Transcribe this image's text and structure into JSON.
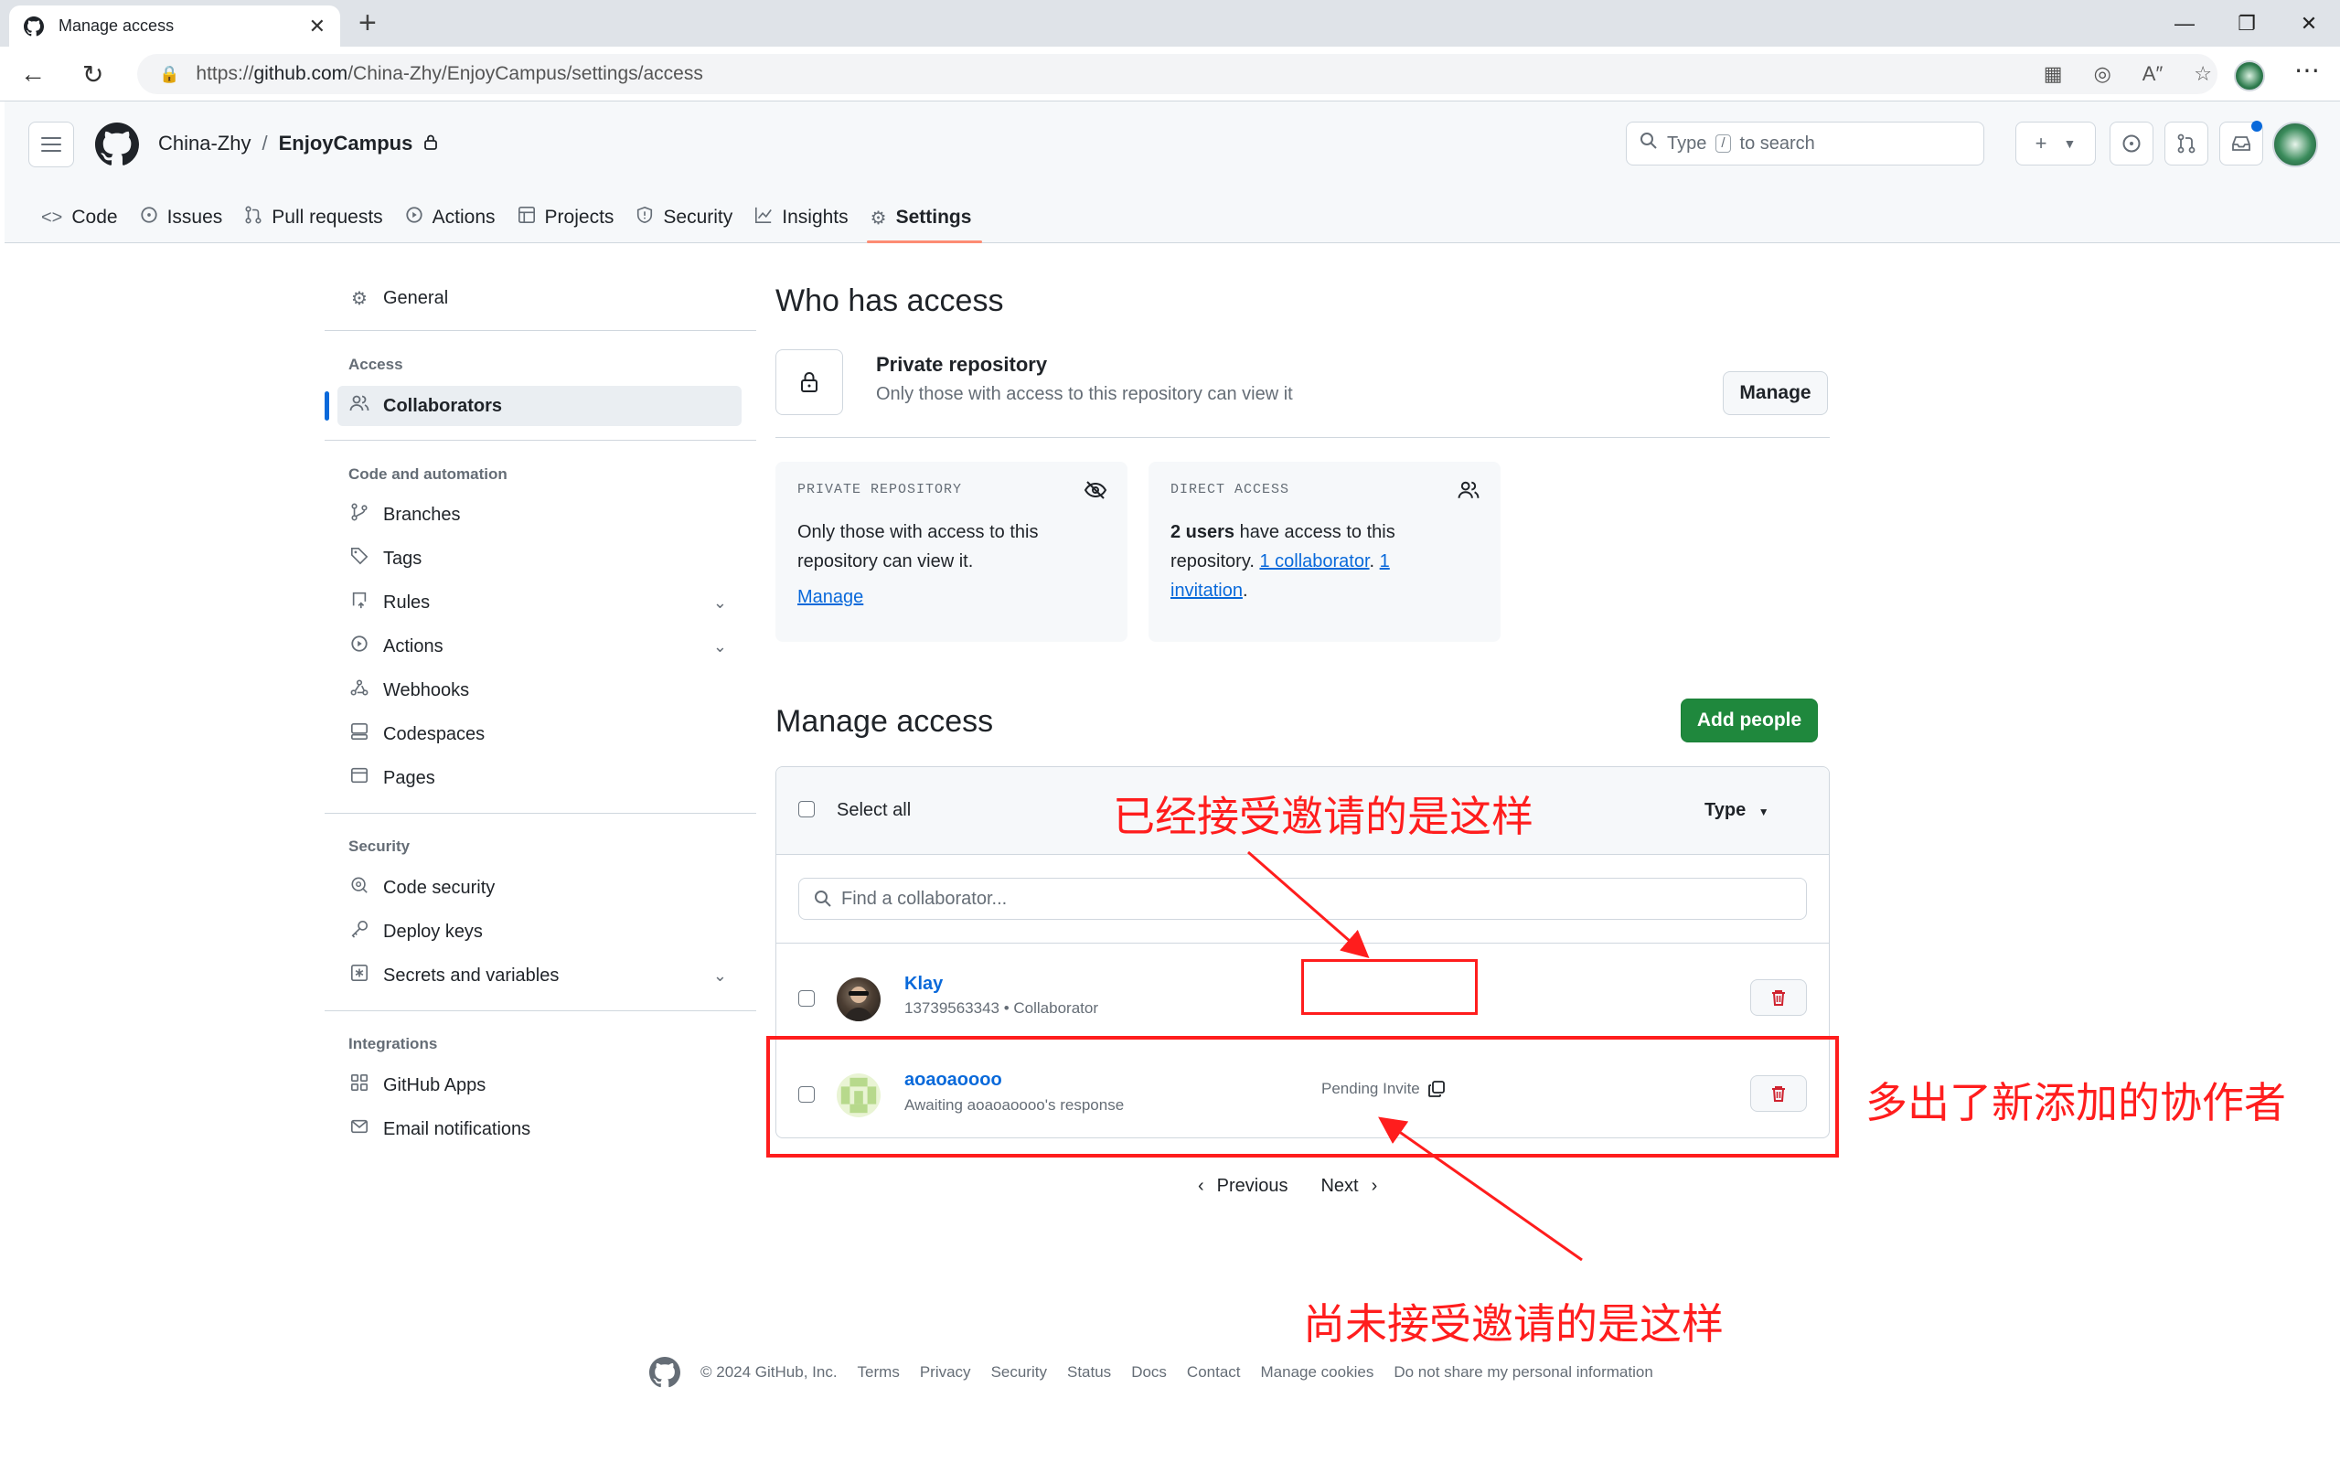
{
  "browser": {
    "tab_title": "Manage access",
    "url_prefix": "https://",
    "url_host": "github.com",
    "url_path": "/China-Zhy/EnjoyCampus/settings/access"
  },
  "header": {
    "owner": "China-Zhy",
    "separator": "/",
    "repo": "EnjoyCampus",
    "search_prefix": "Type",
    "search_key": "/",
    "search_suffix": "to search"
  },
  "repo_tabs": [
    {
      "label": "Code",
      "icon": "code-icon"
    },
    {
      "label": "Issues",
      "icon": "issue-icon"
    },
    {
      "label": "Pull requests",
      "icon": "pull-request-icon"
    },
    {
      "label": "Actions",
      "icon": "play-icon"
    },
    {
      "label": "Projects",
      "icon": "table-icon"
    },
    {
      "label": "Security",
      "icon": "shield-icon"
    },
    {
      "label": "Insights",
      "icon": "graph-icon"
    },
    {
      "label": "Settings",
      "icon": "gear-icon"
    }
  ],
  "sidebar": {
    "general": "General",
    "access_heading": "Access",
    "collaborators": "Collaborators",
    "code_heading": "Code and automation",
    "branches": "Branches",
    "tags": "Tags",
    "rules": "Rules",
    "actions": "Actions",
    "webhooks": "Webhooks",
    "codespaces": "Codespaces",
    "pages": "Pages",
    "security_heading": "Security",
    "code_security": "Code security",
    "deploy_keys": "Deploy keys",
    "secrets": "Secrets and variables",
    "integrations_heading": "Integrations",
    "github_apps": "GitHub Apps",
    "email_notifications": "Email notifications"
  },
  "who": {
    "title": "Who has access",
    "private_title": "Private repository",
    "private_desc": "Only those with access to this repository can view it",
    "manage_btn": "Manage"
  },
  "cards": {
    "private_caption": "PRIVATE REPOSITORY",
    "private_line1": "Only those with access to this",
    "private_line2": "repository can view it.",
    "private_link": "Manage",
    "direct_caption": "DIRECT ACCESS",
    "direct_bold": "2 users",
    "direct_text1": " have access to this",
    "direct_text2": "repository. ",
    "direct_link1": "1 collaborator",
    "direct_dot": ". ",
    "direct_link2a": "1",
    "direct_link2b": "invitation",
    "direct_end": "."
  },
  "manage": {
    "title": "Manage access",
    "add_btn": "Add people",
    "select_all": "Select all",
    "type_filter": "Type",
    "find_placeholder": "Find a collaborator..."
  },
  "collaborators": [
    {
      "name": "Klay",
      "sub": "13739563343 • Collaborator",
      "status": ""
    },
    {
      "name": "aoaoaoooo",
      "sub": "Awaiting aoaoaoooo's response",
      "status": "Pending Invite"
    }
  ],
  "pager": {
    "previous": "Previous",
    "next": "Next"
  },
  "footer": {
    "copyright": "© 2024 GitHub, Inc.",
    "links": [
      "Terms",
      "Privacy",
      "Security",
      "Status",
      "Docs",
      "Contact",
      "Manage cookies",
      "Do not share my personal information"
    ]
  },
  "annotations": {
    "accepted": "已经接受邀请的是这样",
    "new_collab": "多出了新添加的协作者",
    "pending": "尚未接受邀请的是这样",
    "color": "#ff1d1d"
  }
}
